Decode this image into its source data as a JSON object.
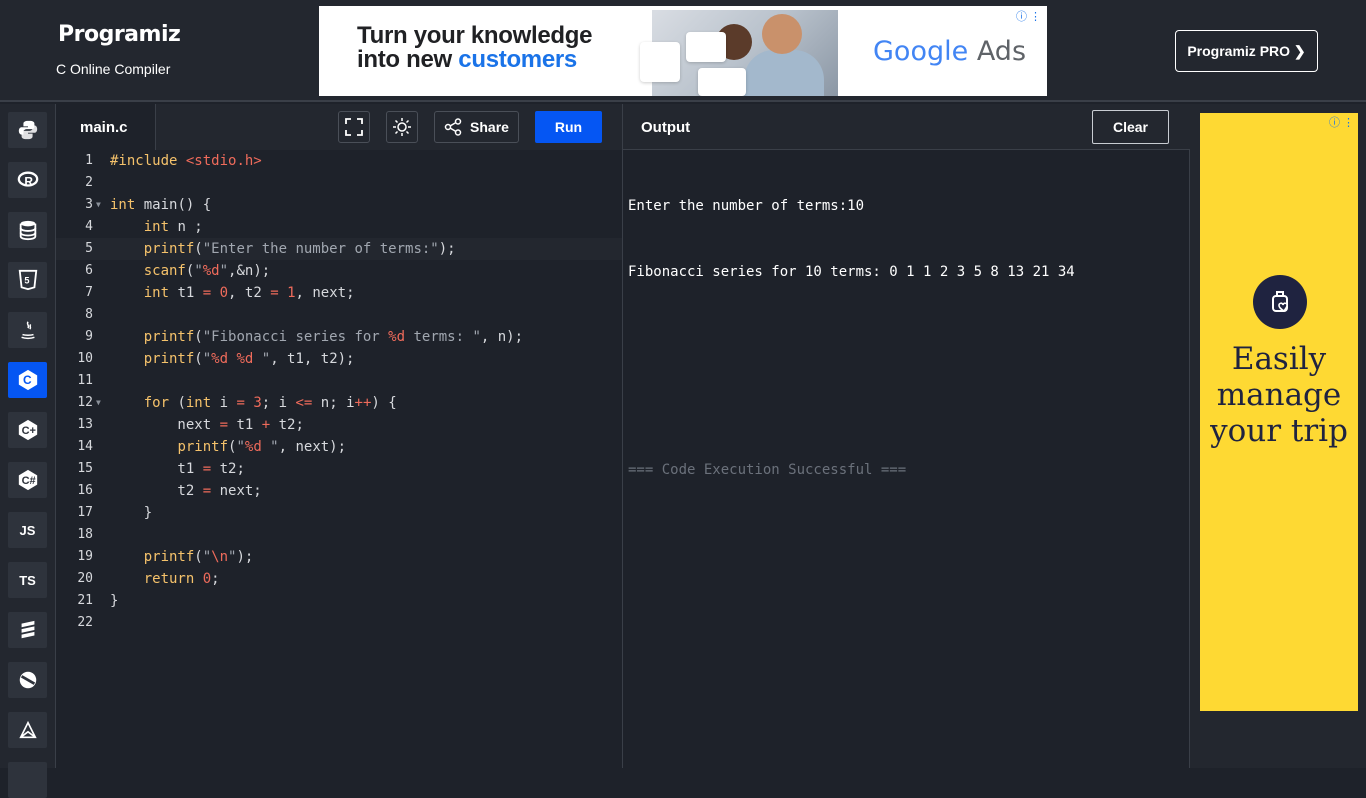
{
  "header": {
    "logo": "Programiz",
    "subtitle": "C Online Compiler",
    "pro_button": "Programiz PRO ❯"
  },
  "ad_banner": {
    "line1": "Turn your knowledge",
    "line2_prefix": "into new ",
    "line2_highlight": "customers",
    "brand_google": "Google",
    "brand_ads": "Ads"
  },
  "sidebar": {
    "items": [
      {
        "name": "python",
        "icon": "python-icon"
      },
      {
        "name": "r",
        "icon": "r-icon"
      },
      {
        "name": "sql",
        "icon": "database-icon"
      },
      {
        "name": "html",
        "icon": "html5-icon"
      },
      {
        "name": "java",
        "icon": "java-icon"
      },
      {
        "name": "c",
        "icon": "c-icon",
        "active": true
      },
      {
        "name": "cpp",
        "icon": "cpp-icon"
      },
      {
        "name": "csharp",
        "icon": "csharp-icon"
      },
      {
        "name": "js",
        "label": "JS"
      },
      {
        "name": "ts",
        "label": "TS"
      },
      {
        "name": "swift",
        "icon": "stack-icon"
      },
      {
        "name": "go",
        "icon": "go-icon"
      },
      {
        "name": "php",
        "icon": "php-icon"
      }
    ]
  },
  "editor": {
    "tab": "main.c",
    "share_label": "Share",
    "run_label": "Run",
    "line_numbers": [
      "1",
      "2",
      "3",
      "4",
      "5",
      "6",
      "7",
      "8",
      "9",
      "10",
      "11",
      "12",
      "13",
      "14",
      "15",
      "16",
      "17",
      "18",
      "19",
      "20",
      "21",
      "22"
    ]
  },
  "output": {
    "title": "Output",
    "clear_label": "Clear",
    "lines": [
      "Enter the number of terms:10",
      "Fibonacci series for 10 terms: 0 1 1 2 3 5 8 13 21 34",
      "",
      "",
      "=== Code Execution Successful ==="
    ]
  },
  "right_ad": {
    "copy": "Easily manage your trip"
  },
  "colors": {
    "accent": "#0556f3",
    "background": "#1e222a",
    "panel": "#23272f",
    "ad_yellow": "#fed933"
  }
}
